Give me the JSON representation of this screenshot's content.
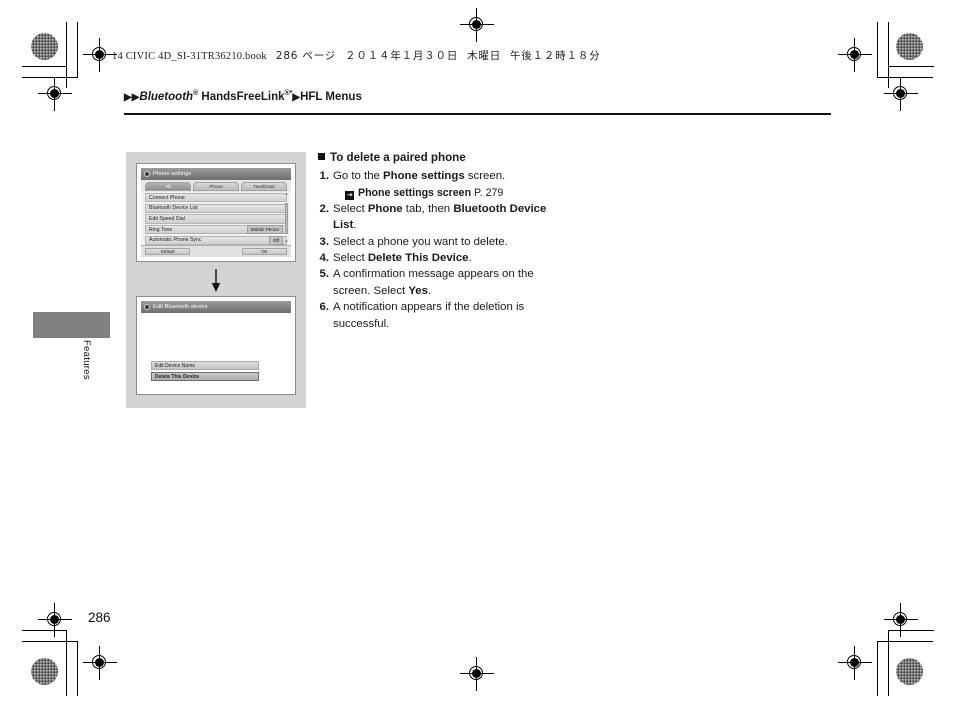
{
  "slug": {
    "book": "14 CIVIC 4D_SI-31TR36210.book",
    "page_label": "286 ページ",
    "date": "２０１４年１月３０日",
    "weekday": "木曜日",
    "time": "午後１２時１８分"
  },
  "breadcrumb": {
    "arrow1": "▶▶",
    "item1": "Bluetooth",
    "item1_sup": "®",
    "item2": "HandsFreeLink",
    "item2_sup": "®*",
    "arrow2": "▶",
    "item3": "HFL Menus"
  },
  "side_tab": {
    "label": "Features"
  },
  "section": {
    "heading": "To delete a paired phone",
    "steps": [
      {
        "num": "1.",
        "parts": [
          {
            "t": "Go to the ",
            "b": false
          },
          {
            "t": "Phone settings",
            "b": true
          },
          {
            "t": " screen.",
            "b": false
          }
        ]
      },
      {
        "num": "2.",
        "parts": [
          {
            "t": "Select ",
            "b": false
          },
          {
            "t": "Phone",
            "b": true
          },
          {
            "t": " tab, then ",
            "b": false
          },
          {
            "t": "Bluetooth Device List",
            "b": true
          },
          {
            "t": ".",
            "b": false
          }
        ]
      },
      {
        "num": "3.",
        "parts": [
          {
            "t": "Select a phone you want to delete.",
            "b": false
          }
        ]
      },
      {
        "num": "4.",
        "parts": [
          {
            "t": "Select ",
            "b": false
          },
          {
            "t": "Delete This Device",
            "b": true
          },
          {
            "t": ".",
            "b": false
          }
        ]
      },
      {
        "num": "5.",
        "parts": [
          {
            "t": "A confirmation message appears on the screen. Select ",
            "b": false
          },
          {
            "t": "Yes",
            "b": true
          },
          {
            "t": ".",
            "b": false
          }
        ]
      },
      {
        "num": "6.",
        "parts": [
          {
            "t": "A notification appears if the deletion is successful.",
            "b": false
          }
        ]
      }
    ],
    "reference": {
      "icon": "⇥",
      "label": "Phone settings screen",
      "page": "P. 279"
    }
  },
  "screens": [
    {
      "title": "Phone settings",
      "tabs": [
        {
          "label": "All",
          "selected": true
        },
        {
          "label": "Phone",
          "selected": false
        },
        {
          "label": "Text/Email",
          "selected": false
        }
      ],
      "rows": [
        {
          "label": "Connect Phone",
          "value": ""
        },
        {
          "label": "Bluetooth Device List",
          "value": ""
        },
        {
          "label": "Edit Speed Dial",
          "value": ""
        },
        {
          "label": "Ring Tone",
          "value": "Mobile Phone"
        },
        {
          "label": "Automatic Phone Sync",
          "value": "Off"
        }
      ],
      "scroll_up": "⌃",
      "scroll_down": "⌄",
      "buttons": [
        {
          "label": "Default"
        },
        {
          "label": "OK"
        }
      ]
    },
    {
      "title": "Edit Bluetooth device",
      "items": [
        {
          "label": "Edit Device Name",
          "highlighted": false
        },
        {
          "label": "Delete This Device",
          "highlighted": true
        }
      ]
    }
  ],
  "page_number": "286"
}
